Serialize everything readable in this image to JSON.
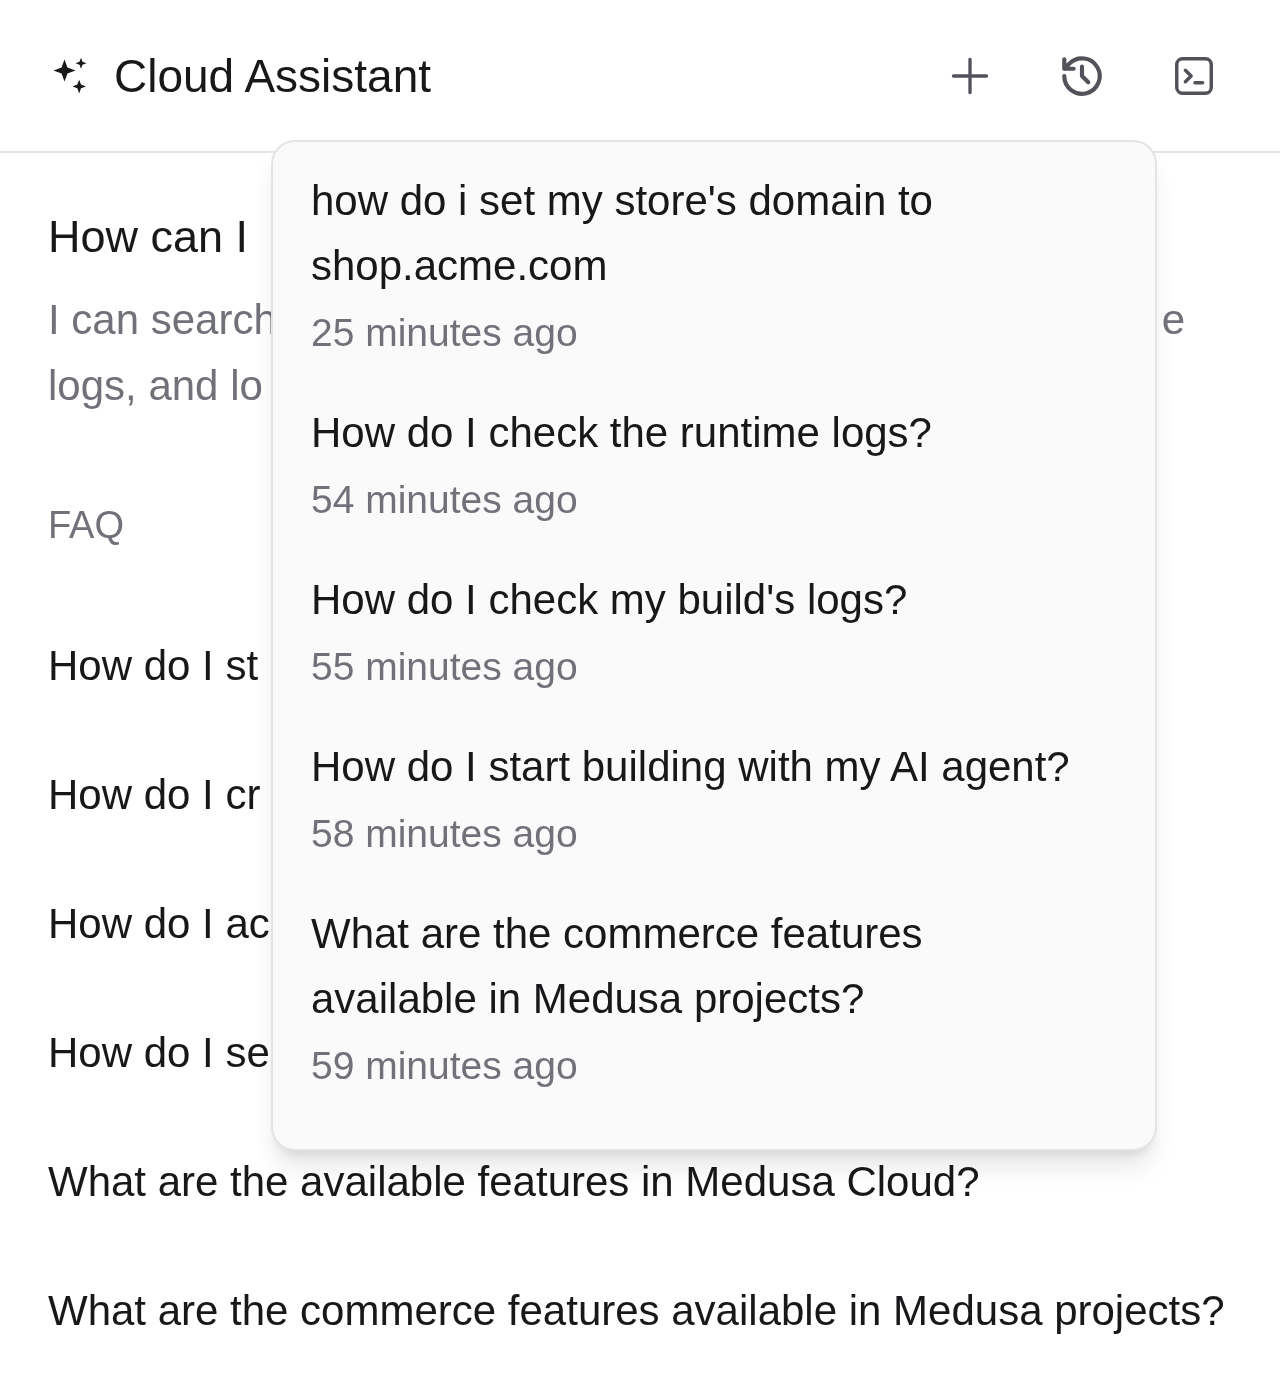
{
  "header": {
    "title": "Cloud Assistant"
  },
  "intro": {
    "heading": "How can I",
    "line_1": "I can search",
    "line_1_right": "e",
    "line_2": "logs, and lo"
  },
  "faq": {
    "label": "FAQ",
    "items": [
      "How do I st",
      "How do I cr",
      "How do I ac",
      "How do I se",
      "What are the available features in Medusa Cloud?",
      "What are the commerce features available in Medusa projects?"
    ]
  },
  "history_menu": {
    "items": [
      {
        "title": "how do i set my store's domain to shop.acme.com",
        "time": "25 minutes ago"
      },
      {
        "title": "How do I check the runtime logs?",
        "time": "54 minutes ago"
      },
      {
        "title": "How do I check my build's logs?",
        "time": "55 minutes ago"
      },
      {
        "title": "How do I start building with my AI agent?",
        "time": "58 minutes ago"
      },
      {
        "title": "What are the commerce features available in Medusa projects?",
        "time": "59 minutes ago"
      }
    ]
  }
}
